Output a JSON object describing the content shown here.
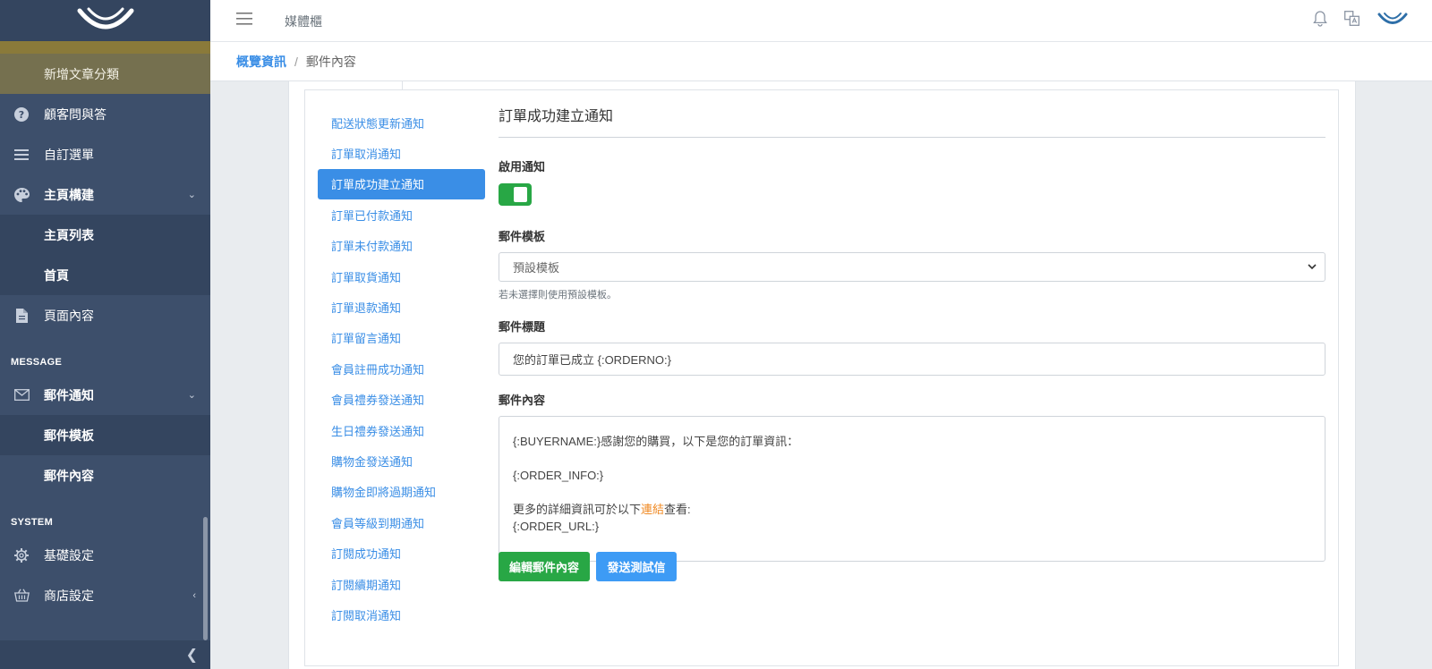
{
  "app": {
    "title": "媒體櫃"
  },
  "breadcrumb": {
    "home": "概覽資訊",
    "separator": "/",
    "current": "郵件內容"
  },
  "sidebar": {
    "items": [
      {
        "label": "新增文章分類",
        "icon": "none"
      },
      {
        "label": "顧客問與答",
        "icon": "question-circle-icon"
      },
      {
        "label": "自訂選單",
        "icon": "list-icon"
      },
      {
        "label": "主頁構建",
        "icon": "palette-icon",
        "expanded": true
      },
      {
        "label": "主頁列表"
      },
      {
        "label": "首頁"
      },
      {
        "label": "頁面內容",
        "icon": "file-icon"
      }
    ],
    "section_message": "MESSAGE",
    "message_items": [
      {
        "label": "郵件通知",
        "icon": "envelope-icon",
        "expanded": true
      },
      {
        "label": "郵件模板"
      },
      {
        "label": "郵件內容",
        "active": true
      }
    ],
    "section_system": "SYSTEM",
    "system_items": [
      {
        "label": "基礎設定",
        "icon": "gear-icon"
      },
      {
        "label": "商店設定",
        "icon": "basket-icon"
      }
    ]
  },
  "menu": {
    "items": [
      "配送狀態更新通知",
      "訂單取消通知",
      "訂單成功建立通知",
      "訂單已付款通知",
      "訂單未付款通知",
      "訂單取貨通知",
      "訂單退款通知",
      "訂單留言通知",
      "會員註冊成功通知",
      "會員禮券發送通知",
      "生日禮券發送通知",
      "購物金發送通知",
      "購物金即將過期通知",
      "會員等級到期通知",
      "訂閱成功通知",
      "訂閱續期通知",
      "訂閱取消通知"
    ],
    "active_index": 2
  },
  "form": {
    "title": "訂單成功建立通知",
    "enable_label": "啟用通知",
    "enabled": true,
    "template_label": "郵件模板",
    "template_value": "預設模板",
    "template_hint": "若未選擇則使用預設模板。",
    "subject_label": "郵件標題",
    "subject_value": "您的訂單已成立 {:ORDERNO:}",
    "body_label": "郵件內容",
    "body_line1": "{:BUYERNAME:}感謝您的購買，以下是您的訂單資訊：",
    "body_line2": "{:ORDER_INFO:}",
    "body_line3_pre": "更多的詳細資訊可於以下",
    "body_line3_link": "連結",
    "body_line3_post": "查看:",
    "body_line4": "{:ORDER_URL:}",
    "edit_button": "編輯郵件內容",
    "test_button": "發送測試信"
  },
  "colors": {
    "accent": "#3a8ee6",
    "success": "#28a745",
    "sidebar": "#3d4f6b",
    "link_highlight": "#f08a24"
  }
}
